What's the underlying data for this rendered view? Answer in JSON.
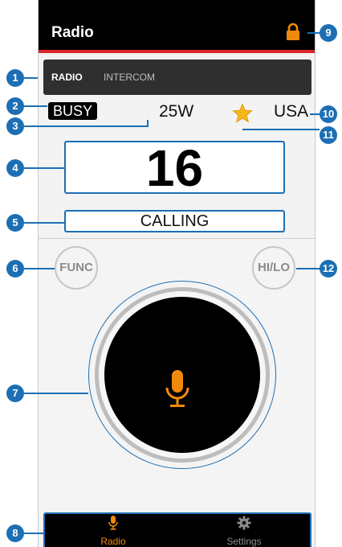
{
  "app": {
    "title": "Radio"
  },
  "tabs": {
    "radio": "RADIO",
    "intercom": "INTERCOM"
  },
  "status": {
    "busy": "BUSY",
    "power": "25W",
    "region": "USA"
  },
  "channel": {
    "number": "16",
    "status_text": "CALLING"
  },
  "buttons": {
    "func": "FUNC",
    "hilo": "HI/LO"
  },
  "nav": {
    "radio": "Radio",
    "settings": "Settings"
  },
  "callouts": [
    "1",
    "2",
    "3",
    "4",
    "5",
    "6",
    "7",
    "8",
    "9",
    "10",
    "11",
    "12"
  ],
  "colors": {
    "accent": "#f08a0c",
    "callout": "#1d6fb4",
    "alert_bar": "#d8262a",
    "star": "#f5b81a"
  },
  "icons": {
    "lock": "lock-icon",
    "star": "star-icon",
    "mic": "microphone-icon",
    "gear": "gear-icon"
  }
}
